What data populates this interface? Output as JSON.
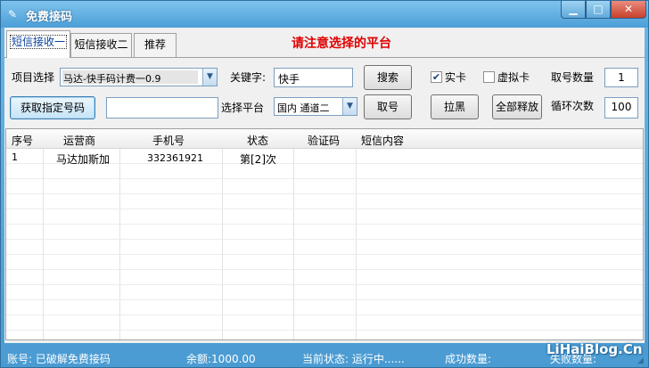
{
  "window": {
    "title": "免费接码",
    "icon": "pen-icon",
    "controls": {
      "minimize": "▁",
      "maximize": "□",
      "close": "✕"
    }
  },
  "tabs": [
    {
      "label": "短信接收一",
      "active": true
    },
    {
      "label": "短信接收二",
      "active": false
    },
    {
      "label": "推荐",
      "active": false
    }
  ],
  "notice": "请注意选择的平台",
  "form": {
    "project_label": "项目选择",
    "project_value": "马达-快手码计费一0.9",
    "keyword_label": "关键字:",
    "keyword_value": "快手",
    "search_button": "搜索",
    "real_card_label": "实卡",
    "real_card_checked": true,
    "virtual_card_label": "虚拟卡",
    "virtual_card_checked": false,
    "fetch_count_label": "取号数量",
    "fetch_count_value": "1",
    "get_number_button": "获取指定号码",
    "specified_number_value": "",
    "platform_label": "选择平台",
    "platform_value": "国内 通道二",
    "fetch_button": "取号",
    "blacklist_button": "拉黑",
    "release_all_button": "全部释放",
    "loop_label": "循环次数",
    "loop_value": "100"
  },
  "table": {
    "columns": [
      "序号",
      "运营商",
      "手机号",
      "状态",
      "验证码",
      "短信内容"
    ],
    "rows": [
      [
        "1",
        "马达加斯加",
        "332361921",
        "第[2]次",
        "",
        ""
      ]
    ]
  },
  "statusbar": {
    "account": "账号: 已破解免费接码",
    "balance": "余额:1000.00",
    "state": "当前状态: 运行中......",
    "success": "成功数量:",
    "fail": "失败数量:"
  },
  "watermark": "LiHaiBlog.Cn",
  "colors": {
    "title_bar": "#4b9fd6",
    "notice": "#e00000",
    "active_tab_text": "#0a3f9e",
    "close_button": "#c7412c"
  }
}
